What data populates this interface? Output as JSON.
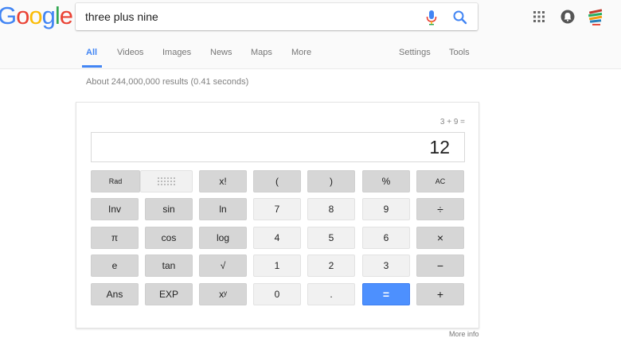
{
  "logo": {
    "letters": [
      {
        "ch": "G",
        "color": "#4285f4"
      },
      {
        "ch": "o",
        "color": "#ea4335"
      },
      {
        "ch": "o",
        "color": "#fbbc05"
      },
      {
        "ch": "g",
        "color": "#4285f4"
      },
      {
        "ch": "l",
        "color": "#34a853"
      },
      {
        "ch": "e",
        "color": "#ea4335"
      }
    ]
  },
  "search": {
    "query": "three plus nine"
  },
  "tabs": {
    "all": "All",
    "videos": "Videos",
    "images": "Images",
    "news": "News",
    "maps": "Maps",
    "more": "More",
    "settings": "Settings",
    "tools": "Tools"
  },
  "results": {
    "stats": "About 244,000,000 results (0.41 seconds)"
  },
  "calculator": {
    "expression": "3 + 9 =",
    "display": "12",
    "keys": {
      "rad": "Rad",
      "fact": "x!",
      "lparen": "(",
      "rparen": ")",
      "percent": "%",
      "ac": "AC",
      "inv": "Inv",
      "sin": "sin",
      "ln": "ln",
      "d7": "7",
      "d8": "8",
      "d9": "9",
      "div": "÷",
      "pi": "π",
      "cos": "cos",
      "log": "log",
      "d4": "4",
      "d5": "5",
      "d6": "6",
      "mul": "×",
      "e": "e",
      "tan": "tan",
      "sqrt": "√",
      "d1": "1",
      "d2": "2",
      "d3": "3",
      "minus": "−",
      "ans": "Ans",
      "exp": "EXP",
      "pow": "xʸ",
      "d0": "0",
      "dot": ".",
      "equals": "=",
      "plus": "+"
    }
  },
  "footer": {
    "more_info": "More info"
  },
  "colors": {
    "accent": "#4285f4",
    "equals_button": "#4d90fe"
  },
  "icons": {
    "mic": "microphone-icon",
    "search": "search-icon",
    "apps": "apps-grid-icon",
    "notifications": "notifications-icon",
    "account": "account-avatar-icon",
    "deg": "deg-keypad-icon"
  }
}
